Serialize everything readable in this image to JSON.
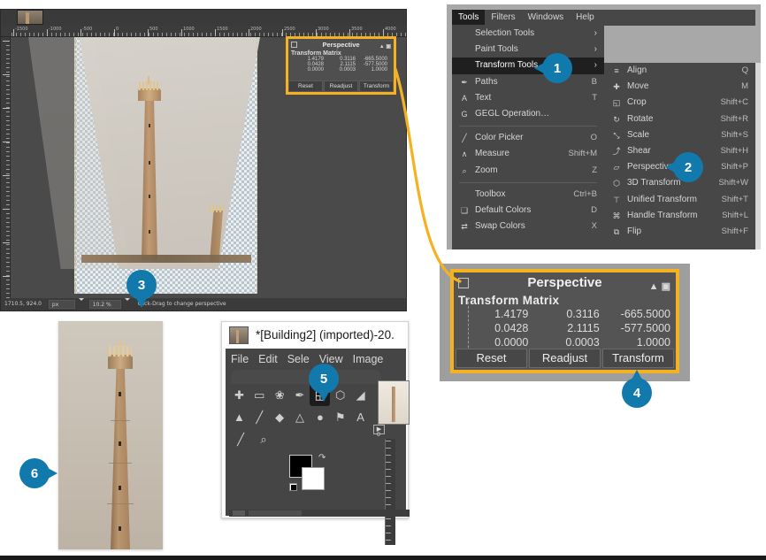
{
  "canvas": {
    "status": {
      "position": "1710.5, 924.0",
      "unit": "px",
      "zoom": "10.2 %",
      "message": "Click-Drag to change perspective"
    },
    "ruler_labels": [
      "-1500",
      "-1000",
      "-500",
      "0",
      "500",
      "1000",
      "1500",
      "2000",
      "2500",
      "3000",
      "3500",
      "4000"
    ]
  },
  "perspective_small": {
    "title": "Perspective",
    "matrix_label": "Transform Matrix",
    "icon": "transform-icon",
    "detach_icon": "detach-icon",
    "close_icon": "close-icon",
    "matrix": [
      [
        "1.4179",
        "0.3116",
        "-665.5000"
      ],
      [
        "0.0428",
        "2.1115",
        "-577.5000"
      ],
      [
        "0.0000",
        "0.0003",
        "1.0000"
      ]
    ],
    "buttons": [
      "Reset",
      "Readjust",
      "Transform"
    ]
  },
  "perspective_large": {
    "title": "Perspective",
    "matrix_label": "Transform Matrix",
    "icon": "transform-icon",
    "detach_icon": "detach-icon",
    "close_icon": "close-icon",
    "matrix": [
      [
        "1.4179",
        "0.3116",
        "-665.5000"
      ],
      [
        "0.0428",
        "2.1115",
        "-577.5000"
      ],
      [
        "0.0000",
        "0.0003",
        "1.0000"
      ]
    ],
    "buttons": [
      "Reset",
      "Readjust",
      "Transform"
    ]
  },
  "menubar": {
    "items": [
      "Tools",
      "Filters",
      "Windows",
      "Help"
    ],
    "active": "Tools"
  },
  "tools_menu": [
    {
      "label": "Selection Tools",
      "icon": "",
      "accel": "",
      "submenu": true,
      "highlight": false
    },
    {
      "label": "Paint Tools",
      "icon": "",
      "accel": "",
      "submenu": true,
      "highlight": false
    },
    {
      "label": "Transform Tools",
      "icon": "",
      "accel": "",
      "submenu": true,
      "highlight": true
    },
    {
      "label": "Paths",
      "icon": "path-icon",
      "accel": "B",
      "submenu": false,
      "highlight": false
    },
    {
      "label": "Text",
      "icon": "text-icon",
      "accel": "T",
      "submenu": false,
      "highlight": false
    },
    {
      "label": "GEGL Operation…",
      "icon": "gegl-icon",
      "accel": "",
      "submenu": false,
      "highlight": false
    },
    {
      "separator": true
    },
    {
      "label": "Color Picker",
      "icon": "eyedropper-icon",
      "accel": "O",
      "submenu": false,
      "highlight": false
    },
    {
      "label": "Measure",
      "icon": "measure-icon",
      "accel": "Shift+M",
      "submenu": false,
      "highlight": false
    },
    {
      "label": "Zoom",
      "icon": "magnifier-icon",
      "accel": "Z",
      "submenu": false,
      "highlight": false
    },
    {
      "separator": true
    },
    {
      "label": "Toolbox",
      "icon": "",
      "accel": "Ctrl+B",
      "submenu": false,
      "highlight": false
    },
    {
      "label": "Default Colors",
      "icon": "default-colors-icon",
      "accel": "D",
      "submenu": false,
      "highlight": false
    },
    {
      "label": "Swap Colors",
      "icon": "swap-colors-icon",
      "accel": "X",
      "submenu": false,
      "highlight": false
    }
  ],
  "transform_submenu": [
    {
      "label": "Align",
      "icon": "align-icon",
      "accel": "Q"
    },
    {
      "label": "Move",
      "icon": "move-icon",
      "accel": "M"
    },
    {
      "label": "Crop",
      "icon": "crop-icon",
      "accel": "Shift+C"
    },
    {
      "label": "Rotate",
      "icon": "rotate-icon",
      "accel": "Shift+R"
    },
    {
      "label": "Scale",
      "icon": "scale-icon",
      "accel": "Shift+S"
    },
    {
      "label": "Shear",
      "icon": "shear-icon",
      "accel": "Shift+H"
    },
    {
      "label": "Perspective",
      "icon": "perspective-icon",
      "accel": "Shift+P"
    },
    {
      "label": "3D Transform",
      "icon": "3d-transform-icon",
      "accel": "Shift+W"
    },
    {
      "label": "Unified Transform",
      "icon": "unified-transform-icon",
      "accel": "Shift+T"
    },
    {
      "label": "Handle Transform",
      "icon": "handle-transform-icon",
      "accel": "Shift+L"
    },
    {
      "label": "Flip",
      "icon": "flip-icon",
      "accel": "Shift+F"
    }
  ],
  "gimp_window": {
    "title": "*[Building2] (imported)-20.",
    "thumb_icon": "image-thumbnail-icon",
    "menu": [
      "File",
      "Edit",
      "Sele",
      "View",
      "Image"
    ],
    "toolbox_rows": [
      [
        "move-icon",
        "rect-select-icon",
        "free-select-icon",
        "path-icon",
        "crop-icon",
        "3d-transform-icon",
        "bucket-fill-icon"
      ],
      [
        "bucket-icon",
        "paintbrush-icon",
        "eraser-icon",
        "smudge-icon",
        "clone-icon",
        "ink-icon",
        "text-icon"
      ],
      [
        "pencil-icon",
        "magnifier-icon"
      ]
    ],
    "ruler_zero": "0",
    "play_icon": "play-icon"
  },
  "badges": [
    {
      "n": "1",
      "dir": "lf"
    },
    {
      "n": "2",
      "dir": "lf"
    },
    {
      "n": "3",
      "dir": "dn"
    },
    {
      "n": "4",
      "dir": "up"
    },
    {
      "n": "5",
      "dir": "dn"
    },
    {
      "n": "6",
      "dir": "rt"
    }
  ],
  "colors": {
    "badge": "#1179ac",
    "highlight_frame": "#f4b223",
    "menu_bg": "#474747",
    "menu_highlight": "#1f1f1f"
  }
}
